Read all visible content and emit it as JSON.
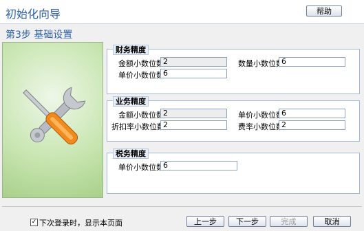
{
  "header": {
    "title": "初始化向导",
    "help_label": "帮助"
  },
  "step": {
    "title": "第3步  基础设置"
  },
  "finance_group": {
    "legend": "财务精度",
    "amount_label": "金额小数位数",
    "amount_value": "2",
    "quantity_label": "数量小数位数",
    "quantity_value": "6",
    "unit_price_label": "单价小数位数",
    "unit_price_value": "6"
  },
  "business_group": {
    "legend": "业务精度",
    "amount_label": "金额小数位数",
    "amount_value": "2",
    "unit_price_label": "单价小数位数",
    "unit_price_value": "6",
    "discount_label": "折扣率小数位数",
    "discount_value": "2",
    "fee_rate_label": "费率小数位数",
    "fee_rate_value": "2"
  },
  "tax_group": {
    "legend": "税务精度",
    "unit_price_label": "单价小数位数",
    "unit_price_value": "6"
  },
  "required_mark": "*",
  "footer": {
    "checkbox_mark": "✓",
    "checkbox_label": "下次登录时，显示本页面",
    "prev_label": "上一步",
    "next_label": "下一步",
    "finish_label": "完成",
    "cancel_label": "取消"
  },
  "icons": {
    "illustration": "tools-icon"
  }
}
